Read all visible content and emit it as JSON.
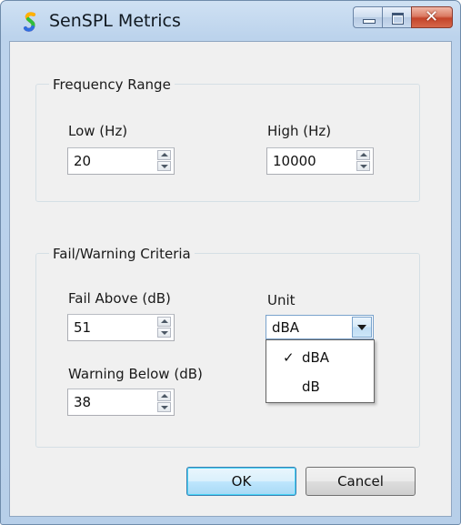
{
  "window": {
    "title": "SenSPL Metrics",
    "icon": "rainbow-s-app-icon",
    "caption_buttons": [
      "minimize-icon",
      "maximize-icon",
      "close-icon"
    ]
  },
  "frequency_range": {
    "group_label": "Frequency Range",
    "low": {
      "label": "Low (Hz)",
      "value": "20"
    },
    "high": {
      "label": "High (Hz)",
      "value": "10000"
    }
  },
  "criteria": {
    "group_label": "Fail/Warning Criteria",
    "fail_above": {
      "label": "Fail Above (dB)",
      "value": "51"
    },
    "warning_below": {
      "label": "Warning Below (dB)",
      "value": "38"
    },
    "unit": {
      "label": "Unit",
      "selected": "dBA",
      "options": [
        {
          "label": "dBA",
          "checked": true,
          "check_mark": "✓"
        },
        {
          "label": "dB",
          "checked": false,
          "check_mark": ""
        }
      ]
    }
  },
  "buttons": {
    "ok": "OK",
    "cancel": "Cancel"
  },
  "colors": {
    "title_bar": "#bcd3ec",
    "client_bg": "#f0f0f0",
    "close_button": "#c3442a",
    "default_button_border": "#3c7fb1"
  }
}
